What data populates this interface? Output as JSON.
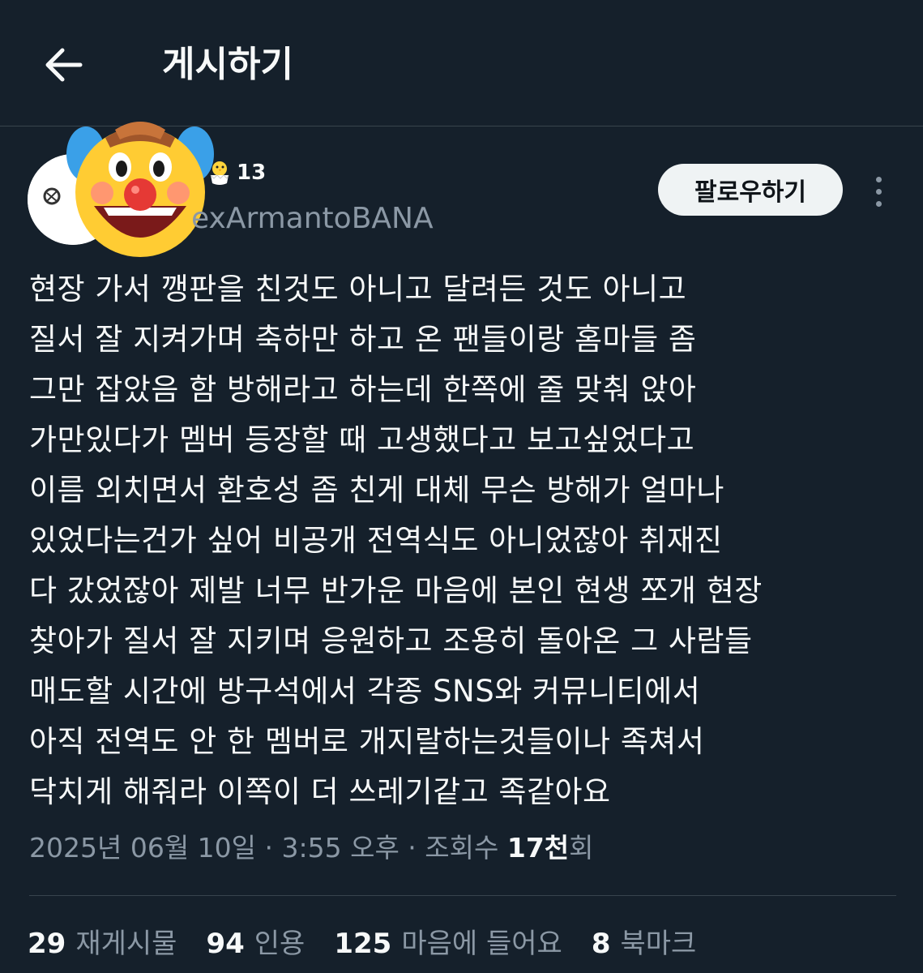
{
  "header": {
    "title": "게시하기"
  },
  "user": {
    "badge_count": "13",
    "handle": "exArmantoBANA"
  },
  "actions": {
    "follow_label": "팔로우하기"
  },
  "post": {
    "lines": [
      "현장 가서 깽판을 친것도 아니고 달려든 것도 아니고",
      "질서 잘 지켜가며 축하만 하고 온 팬들이랑 홈마들 좀",
      "그만 잡았음 함 방해라고 하는데 한쪽에 줄 맞춰 앉아",
      "가만있다가 멤버 등장할 때 고생했다고 보고싶었다고",
      "이름 외치면서 환호성 좀 친게 대체 무슨 방해가 얼마나",
      "있었다는건가 싶어 비공개 전역식도 아니었잖아 취재진",
      "다 갔었잖아 제발 너무 반가운 마음에 본인 현생 쪼개 현장",
      "찾아가 질서 잘 지키며 응원하고 조용히 돌아온 그 사람들",
      "매도할 시간에 방구석에서 각종 SNS와 커뮤니티에서",
      "아직 전역도 안 한 멤버로 개지랄하는것들이나 족쳐서",
      "닥치게 해줘라 이쪽이 더 쓰레기같고 족같아요"
    ]
  },
  "meta": {
    "date_time": "2025년 06월 10일 · 3:55 오후 · 조회수 ",
    "views_number": "17천",
    "views_suffix": "회"
  },
  "stats": {
    "reposts": {
      "count": "29",
      "label": "재게시물"
    },
    "quotes": {
      "count": "94",
      "label": "인용"
    },
    "likes": {
      "count": "125",
      "label": "마음에 들어요"
    },
    "bookmarks": {
      "count": "8",
      "label": "북마크"
    }
  },
  "icons": {
    "back": "arrow-left-icon",
    "more": "more-vertical-icon",
    "badge": "chick-icon",
    "sticker": "clown-face-icon"
  },
  "colors": {
    "background": "#15202b",
    "text": "#f7f9f9",
    "secondary": "#8b98a5",
    "border": "#38444d",
    "follow_bg": "#eff3f4"
  }
}
